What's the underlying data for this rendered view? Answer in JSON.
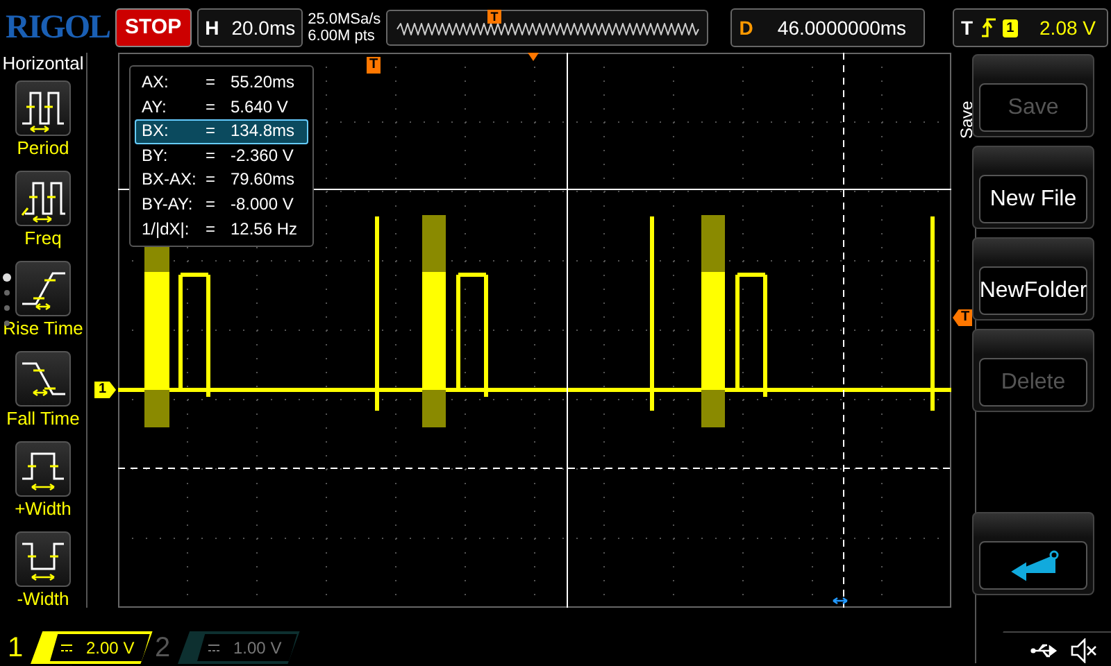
{
  "top_bar": {
    "logo": "RIGOL",
    "run_state": {
      "label": "STOP",
      "running": false
    },
    "timebase": {
      "key": "H",
      "value": "20.0ms"
    },
    "sample_rate": "25.0MSa/s",
    "memory_depth": "6.00M pts",
    "overview_marker": "T",
    "delay": {
      "key": "D",
      "value": "46.0000000ms"
    },
    "trigger": {
      "key": "T",
      "source": "1",
      "level": "2.08 V"
    }
  },
  "left_menu": {
    "title": "Horizontal",
    "items": [
      {
        "kind": "period",
        "label": "Period"
      },
      {
        "kind": "freq",
        "label": "Freq"
      },
      {
        "kind": "rise",
        "label": "Rise Time"
      },
      {
        "kind": "fall",
        "label": "Fall Time"
      },
      {
        "kind": "pwidth",
        "label": "+Width"
      },
      {
        "kind": "nwidth",
        "label": "-Width"
      }
    ]
  },
  "cursor_readout": [
    {
      "label": "AX:",
      "eq": "=",
      "value": "55.20ms",
      "selected": false
    },
    {
      "label": "AY:",
      "eq": "=",
      "value": "5.640 V",
      "selected": false
    },
    {
      "label": "BX:",
      "eq": "=",
      "value": "134.8ms",
      "selected": true
    },
    {
      "label": "BY:",
      "eq": "=",
      "value": "-2.360 V",
      "selected": false
    },
    {
      "label": "BX-AX:",
      "eq": "=",
      "value": "79.60ms",
      "selected": false
    },
    {
      "label": "BY-AY:",
      "eq": "=",
      "value": "-8.000 V",
      "selected": false
    },
    {
      "label": "1/|dX|:",
      "eq": "=",
      "value": "12.56 Hz",
      "selected": false
    }
  ],
  "grid_markers": {
    "trigger_position": "T",
    "channel": "1",
    "trigger_level": "T"
  },
  "right_menu": {
    "title": "Save",
    "items": [
      {
        "kind": "text",
        "label": "Save",
        "disabled": true
      },
      {
        "kind": "text",
        "label": "New File",
        "disabled": false
      },
      {
        "kind": "text",
        "label": "NewFolder",
        "disabled": false
      },
      {
        "kind": "text",
        "label": "Delete",
        "disabled": true
      },
      {
        "kind": "spacer"
      },
      {
        "kind": "return"
      }
    ]
  },
  "channels": [
    {
      "number": "1",
      "scale": "2.00 V",
      "on": true
    },
    {
      "number": "2",
      "scale": "1.00 V",
      "on": false
    }
  ]
}
